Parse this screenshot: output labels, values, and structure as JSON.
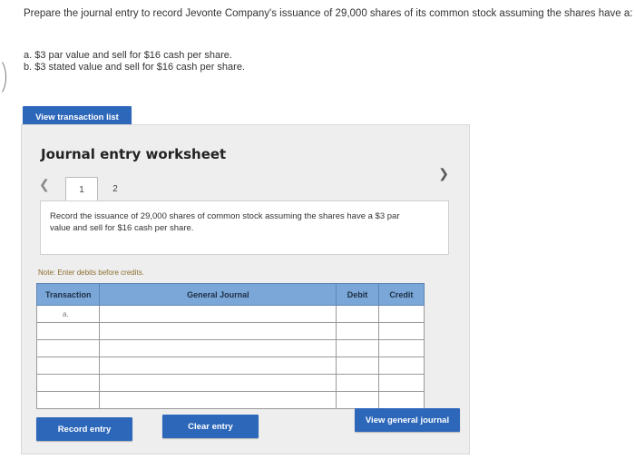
{
  "question": {
    "prompt": "Prepare the journal entry to record Jevonte Company's issuance of 29,000 shares of its common stock assuming the shares have a:",
    "option_a": "a. $3 par value and sell for $16 cash per share.",
    "option_b": "b. $3 stated value and sell for $16 cash per share."
  },
  "buttons": {
    "view_transaction_list": "View transaction list",
    "record_entry": "Record entry",
    "clear_entry": "Clear entry",
    "view_general_journal": "View general journal"
  },
  "worksheet": {
    "title": "Journal entry worksheet",
    "tabs": [
      "1",
      "2"
    ],
    "active_tab": "1",
    "description": "Record the issuance of 29,000 shares of common stock assuming the shares have a $3 par value and sell for $16 cash per share.",
    "note": "Note: Enter debits before credits.",
    "table": {
      "headers": [
        "Transaction",
        "General Journal",
        "Debit",
        "Credit"
      ],
      "rows": [
        [
          "a.",
          "",
          "",
          ""
        ],
        [
          "",
          "",
          "",
          ""
        ],
        [
          "",
          "",
          "",
          ""
        ],
        [
          "",
          "",
          "",
          ""
        ],
        [
          "",
          "",
          "",
          ""
        ],
        [
          "",
          "",
          "",
          ""
        ]
      ]
    }
  },
  "colors": {
    "button_blue": "#2c67ba",
    "table_header": "#7aa7d8",
    "worksheet_bg": "#eeeeee"
  }
}
